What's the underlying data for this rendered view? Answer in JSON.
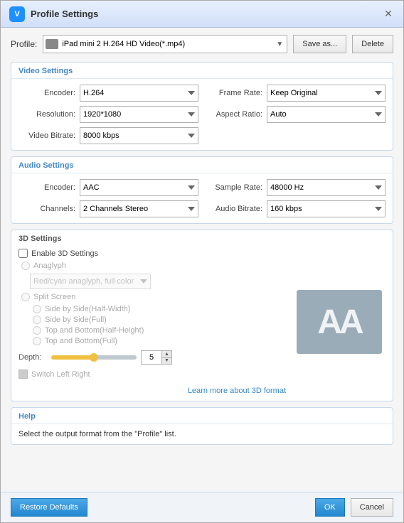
{
  "titleBar": {
    "title": "Profile Settings",
    "appIconLabel": "V",
    "closeLabel": "✕"
  },
  "profileRow": {
    "label": "Profile:",
    "value": "iPad mini 2 H.264 HD Video(*.mp4)",
    "saveAsLabel": "Save as...",
    "deleteLabel": "Delete"
  },
  "videoSettings": {
    "sectionTitle": "Video Settings",
    "encoderLabel": "Encoder:",
    "encoderValue": "H.264",
    "frameRateLabel": "Frame Rate:",
    "frameRateValue": "Keep Original",
    "resolutionLabel": "Resolution:",
    "resolutionValue": "1920*1080",
    "aspectRatioLabel": "Aspect Ratio:",
    "aspectRatioValue": "Auto",
    "videoBitrateLabel": "Video Bitrate:",
    "videoBitrateValue": "8000 kbps"
  },
  "audioSettings": {
    "sectionTitle": "Audio Settings",
    "encoderLabel": "Encoder:",
    "encoderValue": "AAC",
    "sampleRateLabel": "Sample Rate:",
    "sampleRateValue": "48000 Hz",
    "channelsLabel": "Channels:",
    "channelsValue": "2 Channels Stereo",
    "audioBitrateLabel": "Audio Bitrate:",
    "audioBitrateValue": "160 kbps"
  },
  "settings3D": {
    "sectionTitle": "3D Settings",
    "enableLabel": "Enable 3D Settings",
    "anaglyphLabel": "Anaglyph",
    "anaglyphOptionValue": "Red/cyan anaglyph, full color",
    "splitScreenLabel": "Split Screen",
    "splitOptions": [
      "Side by Side(Half-Width)",
      "Side by Side(Full)",
      "Top and Bottom(Half-Height)",
      "Top and Bottom(Full)"
    ],
    "depthLabel": "Depth:",
    "depthValue": "5",
    "switchLabel": "Switch Left Right",
    "learnMoreLabel": "Learn more about 3D format",
    "aaPreviewText": "AA"
  },
  "help": {
    "sectionTitle": "Help",
    "helpText": "Select the output format from the \"Profile\" list."
  },
  "footer": {
    "restoreDefaultsLabel": "Restore Defaults",
    "okLabel": "OK",
    "cancelLabel": "Cancel"
  }
}
